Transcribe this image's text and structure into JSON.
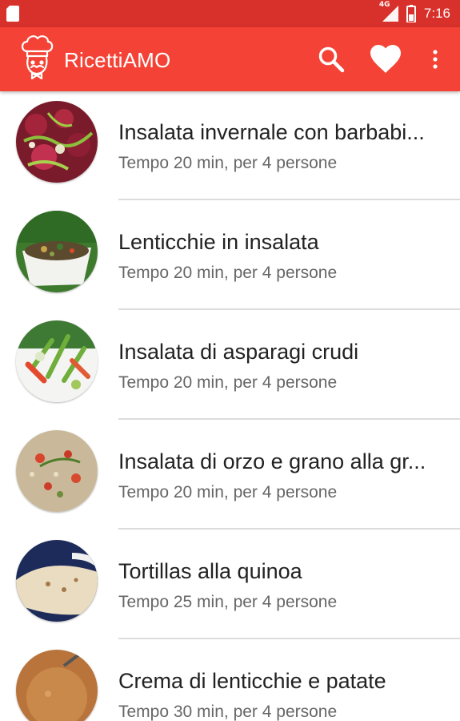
{
  "status_bar": {
    "network": "4G",
    "time": "7:16"
  },
  "app_bar": {
    "title": "RicettiAMO",
    "actions": [
      "search-icon",
      "heart-icon",
      "more-vert-icon"
    ],
    "color": "#f44336",
    "status_color": "#d8302a"
  },
  "recipes": [
    {
      "name": "Insalata invernale con barbabi...",
      "meta": "Tempo 20 min, per 4 persone"
    },
    {
      "name": "Lenticchie in insalata",
      "meta": "Tempo 20 min, per 4 persone"
    },
    {
      "name": "Insalata di asparagi crudi",
      "meta": "Tempo 20 min, per 4 persone"
    },
    {
      "name": "Insalata di orzo e grano alla gr...",
      "meta": "Tempo 20 min, per 4 persone"
    },
    {
      "name": "Tortillas alla quinoa",
      "meta": "Tempo 25 min, per 4 persone"
    },
    {
      "name": "Crema di lenticchie e patate",
      "meta": "Tempo 30 min, per 4 persone"
    }
  ]
}
